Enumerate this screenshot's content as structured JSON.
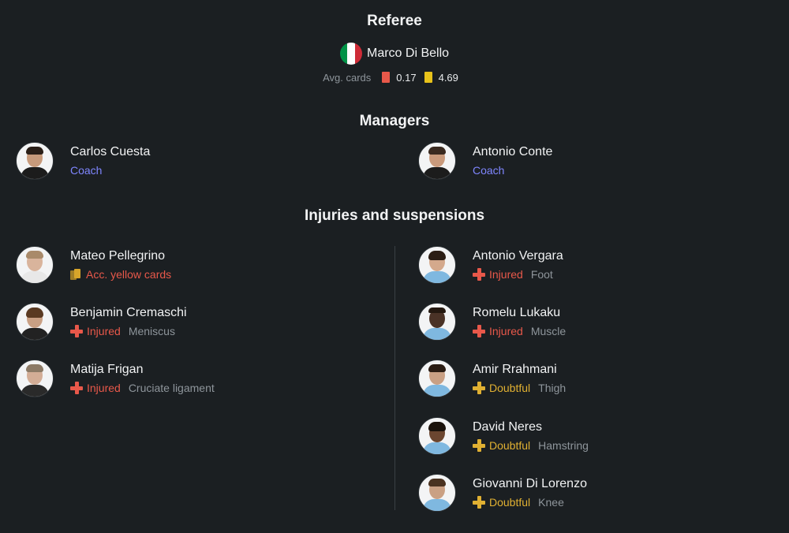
{
  "referee": {
    "title": "Referee",
    "name": "Marco Di Bello",
    "flag_colors": [
      "#009246",
      "#ffffff",
      "#ce2b37"
    ],
    "avg_cards_label": "Avg. cards",
    "red_avg": "0.17",
    "yellow_avg": "4.69",
    "red_color": "#e8584a",
    "yellow_color": "#e8c21a"
  },
  "managers": {
    "title": "Managers",
    "home": {
      "name": "Carlos Cuesta",
      "role": "Coach"
    },
    "away": {
      "name": "Antonio Conte",
      "role": "Coach"
    }
  },
  "injuries": {
    "title": "Injuries and suspensions",
    "home": [
      {
        "name": "Mateo Pellegrino",
        "status": "Acc. yellow cards",
        "type": "yellowcards",
        "detail": ""
      },
      {
        "name": "Benjamin Cremaschi",
        "status": "Injured",
        "type": "injured",
        "detail": "Meniscus"
      },
      {
        "name": "Matija Frigan",
        "status": "Injured",
        "type": "injured",
        "detail": "Cruciate ligament"
      }
    ],
    "away": [
      {
        "name": "Antonio Vergara",
        "status": "Injured",
        "type": "injured",
        "detail": "Foot"
      },
      {
        "name": "Romelu Lukaku",
        "status": "Injured",
        "type": "injured",
        "detail": "Muscle"
      },
      {
        "name": "Amir Rrahmani",
        "status": "Doubtful",
        "type": "doubtful",
        "detail": "Thigh"
      },
      {
        "name": "David Neres",
        "status": "Doubtful",
        "type": "doubtful",
        "detail": "Hamstring"
      },
      {
        "name": "Giovanni Di Lorenzo",
        "status": "Doubtful",
        "type": "doubtful",
        "detail": "Knee"
      }
    ]
  },
  "colors": {
    "background": "#1b1f22",
    "coach_link": "#7f86ff",
    "injured": "#e8584a",
    "doubtful": "#e0b032",
    "muted": "#8e959b"
  }
}
